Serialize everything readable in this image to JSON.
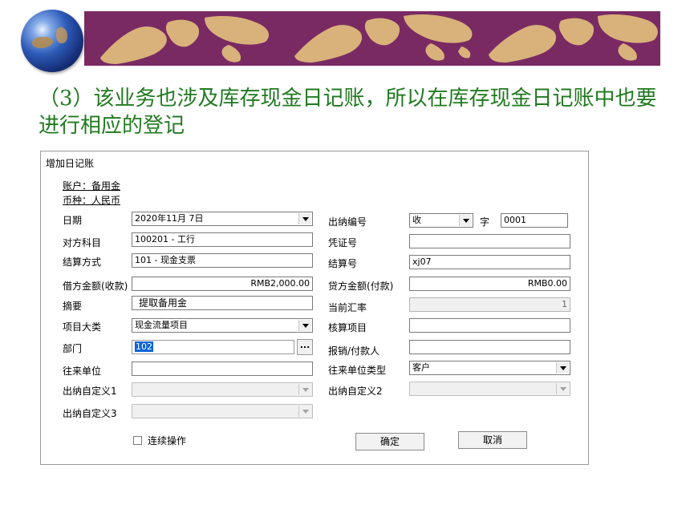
{
  "heading": "（3）该业务也涉及库存现金日记账，所以在库存现金日记账中也要进行相应的登记",
  "dialog": {
    "title": "增加日记账",
    "account": "账户：备用金",
    "currency": "币种：人民币",
    "labels": {
      "date": "日期",
      "counter_account": "对方科目",
      "settlement_method": "结算方式",
      "debit_amount": "借方金额(收款)",
      "summary": "摘要",
      "project_category": "项目大类",
      "department": "部门",
      "contact_unit": "往来单位",
      "custom1": "出纳自定义1",
      "custom3": "出纳自定义3",
      "cashier_no": "出纳编号",
      "word": "字",
      "voucher_no": "凭证号",
      "settlement_no": "结算号",
      "credit_amount": "贷方金额(付款)",
      "exchange_rate": "当前汇率",
      "accounting_item": "核算项目",
      "reimburse_person": "报销/付款人",
      "contact_unit_type": "往来单位类型",
      "custom2": "出纳自定义2"
    },
    "values": {
      "date": "2020年11月 7日",
      "counter_account": "100201 - 工行",
      "settlement_method": "101 - 现金支票",
      "debit_amount": "RMB2,000.00",
      "summary": "提取备用金",
      "project_category": "现金流量项目",
      "department": "102",
      "contact_unit": "",
      "custom1": "",
      "custom3": "",
      "cashier_type": "收",
      "cashier_number": "0001",
      "voucher_no": "",
      "settlement_no": "xj07",
      "credit_amount": "RMB0.00",
      "exchange_rate": "1",
      "accounting_item": "",
      "reimburse_person": "",
      "contact_unit_type": "客户",
      "custom2": ""
    },
    "continuous_label": "连续操作",
    "continuous_checked": false,
    "ok_label": "确定",
    "cancel_label": "取消",
    "ellipsis_label": "..."
  },
  "colors": {
    "banner": "#7a2a63",
    "land": "#d8b27a",
    "heading": "#207a20",
    "selection": "#0a64d8"
  },
  "icons": {
    "globe": "globe-icon",
    "dropdown": "chevron-down-icon",
    "browse": "ellipsis-icon"
  }
}
